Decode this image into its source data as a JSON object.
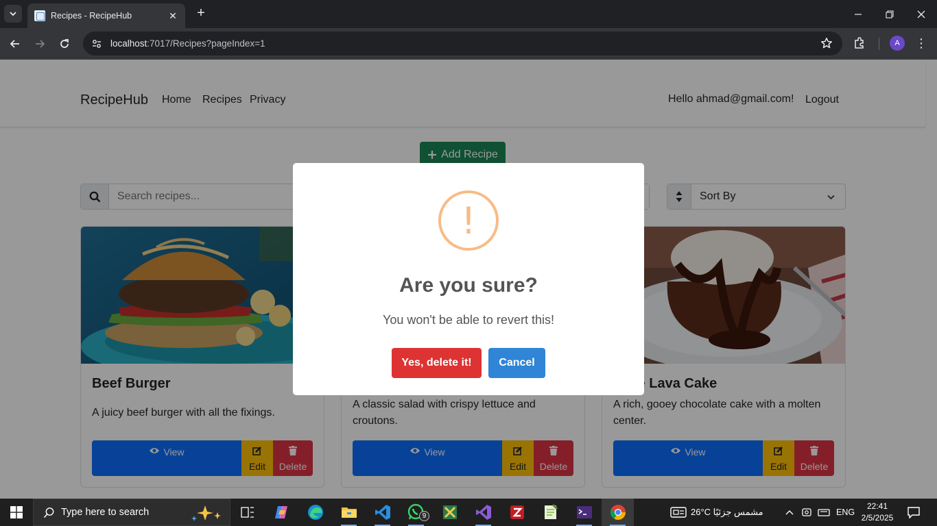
{
  "browser": {
    "tab_title": "Recipes - RecipeHub",
    "url_host": "localhost",
    "url_rest": ":7017/Recipes?pageIndex=1",
    "profile_initial": "A"
  },
  "navbar": {
    "brand": "RecipeHub",
    "links": [
      "Home",
      "Recipes",
      "Privacy"
    ],
    "greeting": "Hello ahmad@gmail.com!",
    "logout": "Logout"
  },
  "toolbar": {
    "add_label": "Add Recipe",
    "search_placeholder": "Search recipes...",
    "sort_label": "Sort By"
  },
  "cards": [
    {
      "title": "Beef Burger",
      "description": "A juicy beef burger with all the fixings.",
      "view": "View",
      "edit": "Edit",
      "delete": "Delete"
    },
    {
      "title": "",
      "description": "A classic salad with crispy lettuce and croutons.",
      "view": "View",
      "edit": "Edit",
      "delete": "Delete"
    },
    {
      "title": "olate Lava Cake",
      "description": "A rich, gooey chocolate cake with a molten center.",
      "view": "View",
      "edit": "Edit",
      "delete": "Delete"
    }
  ],
  "modal": {
    "icon": "!",
    "title": "Are you sure?",
    "text": "You won't be able to revert this!",
    "confirm": "Yes, delete it!",
    "cancel": "Cancel"
  },
  "taskbar": {
    "search_placeholder": "Type here to search",
    "whatsapp_badge": "9",
    "weather": "26°C  مشمس جزئيًا",
    "language": "ENG",
    "time": "22:41",
    "date": "2/5/2025"
  },
  "colors": {
    "success": "#198754",
    "primary": "#0d6efd",
    "warning": "#ffc107",
    "danger": "#dc3545",
    "swal_confirm": "#dd3333",
    "swal_cancel": "#3085d6",
    "swal_warning": "#f8bb86"
  }
}
